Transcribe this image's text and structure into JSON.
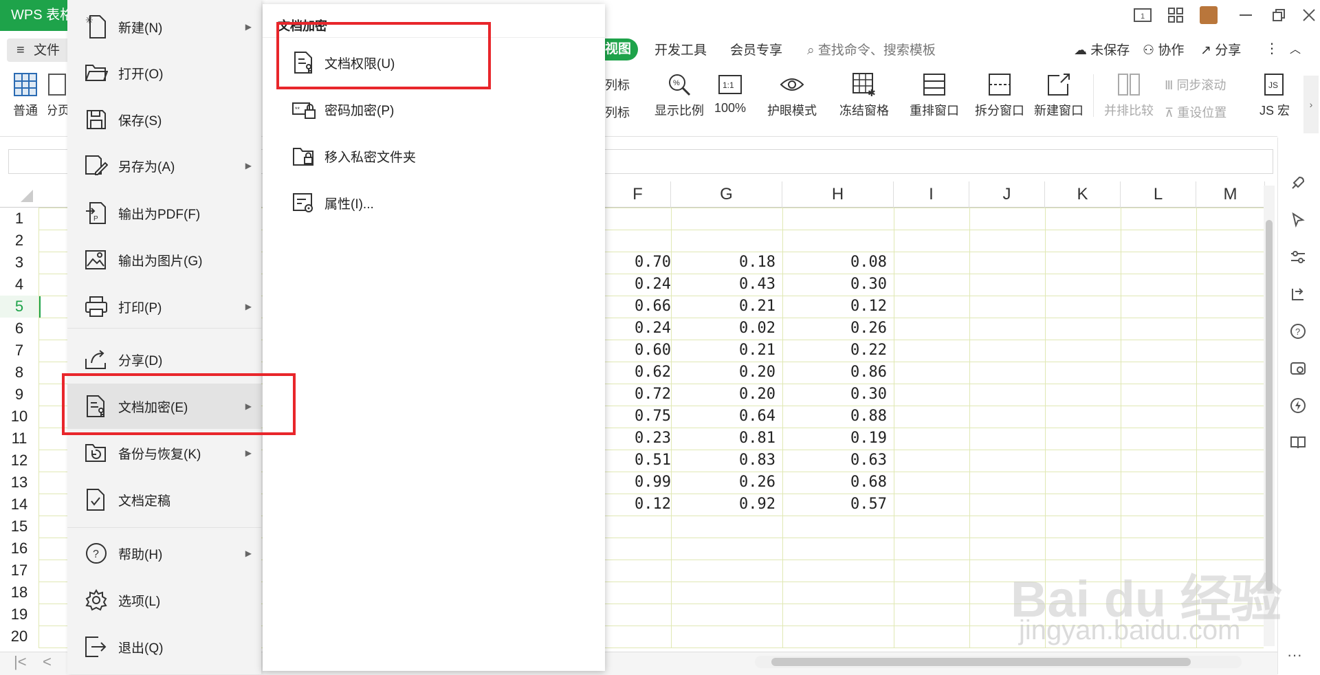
{
  "app": {
    "tab_title": "WPS 表格"
  },
  "ribbon": {
    "file_label": "文件",
    "view_tab": "视图",
    "tabs": [
      "开发工具",
      "会员专享"
    ],
    "search_placeholder": "查找命令、搜索模板",
    "actions": {
      "unsaved": "未保存",
      "collaborate": "协作",
      "share": "分享"
    },
    "left_buttons": {
      "normal": "普通",
      "page": "分页"
    },
    "partial_labels": [
      "列标",
      "列标"
    ],
    "buttons": [
      {
        "label": "显示比例",
        "icon": "zoom-icon"
      },
      {
        "label": "100%",
        "icon": "ratio-1to1-icon"
      },
      {
        "label": "护眼模式",
        "icon": "eye-icon"
      },
      {
        "label": "冻结窗格",
        "icon": "freeze-panes-icon"
      },
      {
        "label": "重排窗口",
        "icon": "arrange-windows-icon"
      },
      {
        "label": "拆分窗口",
        "icon": "split-window-icon"
      },
      {
        "label": "新建窗口",
        "icon": "new-window-icon"
      },
      {
        "label": "并排比较",
        "icon": "side-by-side-icon"
      },
      {
        "label": "JS 宏",
        "icon": "js-macro-icon"
      }
    ],
    "sync_scroll": "同步滚动",
    "reset_position": "重设位置"
  },
  "file_menu": {
    "items": [
      {
        "label": "新建(N)",
        "icon": "new-file-icon",
        "has_submenu": true
      },
      {
        "label": "打开(O)",
        "icon": "folder-open-icon",
        "has_submenu": false
      },
      {
        "label": "保存(S)",
        "icon": "save-icon",
        "has_submenu": false
      },
      {
        "label": "另存为(A)",
        "icon": "save-as-icon",
        "has_submenu": true
      },
      {
        "label": "输出为PDF(F)",
        "icon": "export-pdf-icon",
        "has_submenu": false
      },
      {
        "label": "输出为图片(G)",
        "icon": "export-image-icon",
        "has_submenu": false
      },
      {
        "label": "打印(P)",
        "icon": "printer-icon",
        "has_submenu": true
      },
      {
        "label": "分享(D)",
        "icon": "share-icon",
        "has_submenu": false
      },
      {
        "label": "文档加密(E)",
        "icon": "document-encrypt-icon",
        "has_submenu": true,
        "selected": true
      },
      {
        "label": "备份与恢复(K)",
        "icon": "backup-icon",
        "has_submenu": true
      },
      {
        "label": "文档定稿",
        "icon": "finalize-icon",
        "has_submenu": false
      },
      {
        "label": "帮助(H)",
        "icon": "help-icon",
        "has_submenu": true
      },
      {
        "label": "选项(L)",
        "icon": "settings-icon",
        "has_submenu": false
      },
      {
        "label": "退出(Q)",
        "icon": "exit-icon",
        "has_submenu": false
      }
    ]
  },
  "submenu": {
    "title": "文档加密",
    "items": [
      {
        "label": "文档权限(U)",
        "icon": "document-permission-icon"
      },
      {
        "label": "密码加密(P)",
        "icon": "password-lock-icon"
      },
      {
        "label": "移入私密文件夹",
        "icon": "private-folder-icon"
      },
      {
        "label": "属性(I)...",
        "icon": "properties-icon"
      }
    ]
  },
  "grid": {
    "columns": [
      "F",
      "G",
      "H",
      "I",
      "J",
      "K",
      "L",
      "M"
    ],
    "row_numbers": [
      "1",
      "2",
      "3",
      "4",
      "5",
      "6",
      "7",
      "8",
      "9",
      "10",
      "11",
      "12",
      "13",
      "14",
      "15",
      "16",
      "17",
      "18",
      "19",
      "20"
    ],
    "active_row": "5",
    "values_F": [
      "0.70",
      "0.24",
      "0.66",
      "0.24",
      "0.60",
      "0.62",
      "0.72",
      "0.75",
      "0.23",
      "0.51",
      "0.99",
      "0.12"
    ],
    "values_G": [
      "0.18",
      "0.43",
      "0.21",
      "0.02",
      "0.21",
      "0.20",
      "0.20",
      "0.64",
      "0.81",
      "0.83",
      "0.26",
      "0.92"
    ],
    "values_H": [
      "0.08",
      "0.30",
      "0.12",
      "0.26",
      "0.22",
      "0.86",
      "0.30",
      "0.88",
      "0.19",
      "0.63",
      "0.68",
      "0.57"
    ]
  },
  "watermark": {
    "line1": "Bai du 经验",
    "line2": "jingyan.baidu.com"
  },
  "colors": {
    "brand_green": "#1ea34a",
    "highlight_red": "#e8262b",
    "grid_line": "#e0e8b4"
  }
}
